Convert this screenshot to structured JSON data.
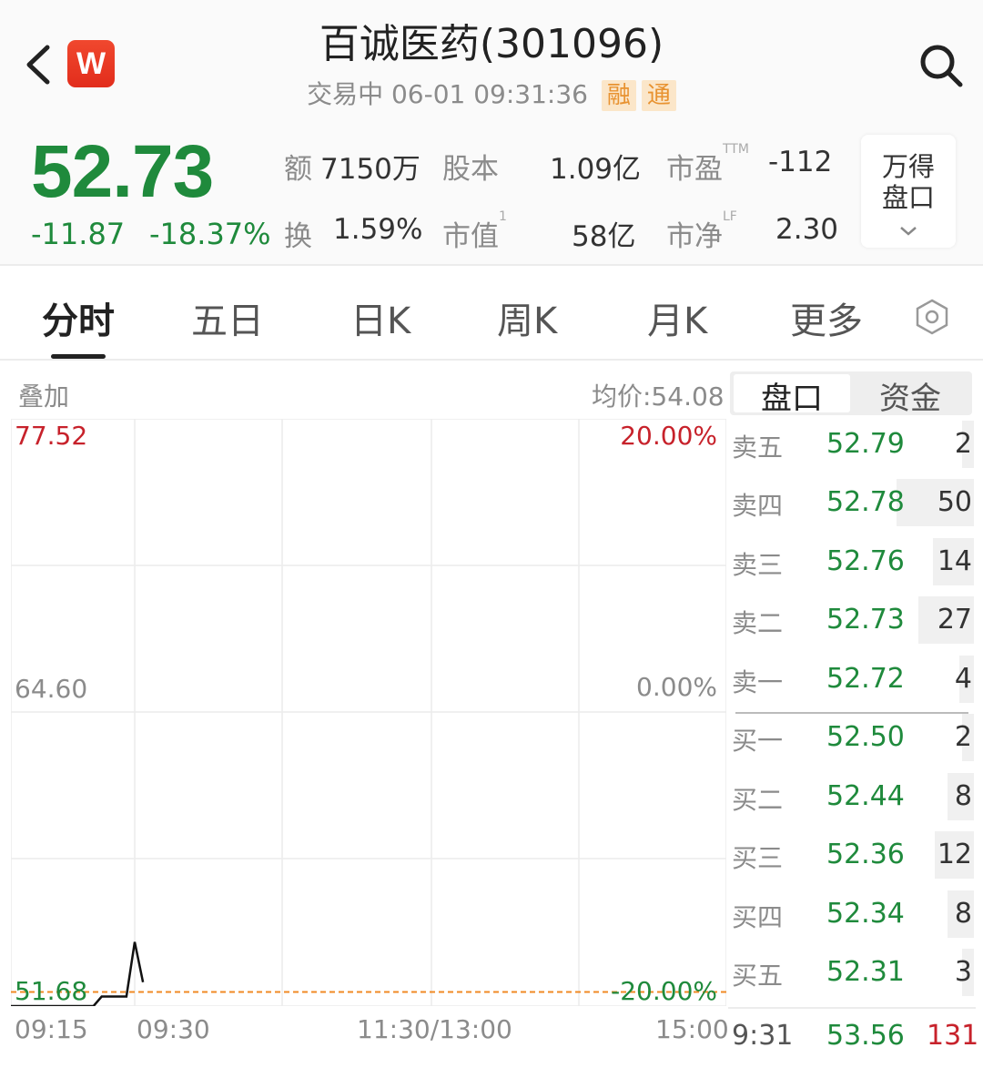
{
  "header": {
    "back_icon": "chevron-left-icon",
    "app_logo_text": "W",
    "title": "百诚医药(301096)",
    "status": "交易中 06-01 09:31:36",
    "tag_margin": "融",
    "tag_connect": "通",
    "search_icon": "search-icon"
  },
  "quote": {
    "price": "52.73",
    "change": "-11.87",
    "change_pct": "-18.37%",
    "amount_label": "额",
    "amount_value": "7150万",
    "turnover_label": "换",
    "turnover_value": "1.59%",
    "share_capital_label": "股本",
    "share_capital_value": "1.09亿",
    "market_cap_label": "市值",
    "market_cap_sup": "1",
    "market_cap_value": "58亿",
    "pe_label": "市盈",
    "pe_sup": "TTM",
    "pe_value": "-112",
    "pb_label": "市净",
    "pb_sup": "LF",
    "pb_value": "2.30",
    "panel_button_line1": "万得",
    "panel_button_line2": "盘口"
  },
  "tabs": [
    {
      "label": "分时",
      "active": true
    },
    {
      "label": "五日"
    },
    {
      "label": "日K"
    },
    {
      "label": "周K"
    },
    {
      "label": "月K"
    },
    {
      "label": "更多"
    }
  ],
  "chart": {
    "overlay_label": "叠加",
    "avg_price": "均价:54.08",
    "y_top": "77.52",
    "y_mid": "64.60",
    "y_bottom": "51.68",
    "pct_top": "20.00%",
    "pct_mid": "0.00%",
    "pct_bottom": "-20.00%",
    "times": [
      "09:15",
      "09:30",
      "11:30/13:00",
      "15:00"
    ]
  },
  "chart_data": {
    "type": "line",
    "title": "",
    "xlabel": "",
    "ylabel": "",
    "x_ticks": [
      "09:15",
      "09:30",
      "11:30/13:00",
      "15:00"
    ],
    "ylim": [
      51.68,
      77.52
    ],
    "pct_range": [
      "-20.00%",
      "20.00%"
    ],
    "prev_close": 64.6,
    "avg_price": 54.08,
    "series": [
      {
        "x": [
          "09:15",
          "09:25",
          "09:26",
          "09:29",
          "09:30",
          "09:31"
        ],
        "y": [
          51.68,
          51.68,
          52.1,
          52.1,
          54.5,
          52.73
        ]
      }
    ],
    "reference_line": {
      "value": 52.3,
      "style": "dashed",
      "color": "#f08a24"
    }
  },
  "orderbook": {
    "tab_panel": "盘口",
    "tab_funds": "资金",
    "asks": [
      {
        "label": "卖五",
        "price": "52.79",
        "vol": "2",
        "bar": 0.05
      },
      {
        "label": "卖四",
        "price": "52.78",
        "vol": "50",
        "bar": 0.32
      },
      {
        "label": "卖三",
        "price": "52.76",
        "vol": "14",
        "bar": 0.17
      },
      {
        "label": "卖二",
        "price": "52.73",
        "vol": "27",
        "bar": 0.23
      },
      {
        "label": "卖一",
        "price": "52.72",
        "vol": "4",
        "bar": 0.06
      }
    ],
    "bids": [
      {
        "label": "买一",
        "price": "52.50",
        "vol": "2",
        "bar": 0.05
      },
      {
        "label": "买二",
        "price": "52.44",
        "vol": "8",
        "bar": 0.11
      },
      {
        "label": "买三",
        "price": "52.36",
        "vol": "12",
        "bar": 0.16
      },
      {
        "label": "买四",
        "price": "52.34",
        "vol": "8",
        "bar": 0.11
      },
      {
        "label": "买五",
        "price": "52.31",
        "vol": "3",
        "bar": 0.05
      }
    ],
    "last_trade": {
      "time": "9:31",
      "price": "53.56",
      "vol": "131"
    }
  },
  "colors": {
    "down": "#1f8a3c",
    "up": "#c7222b",
    "avg_line": "#f08a24"
  }
}
